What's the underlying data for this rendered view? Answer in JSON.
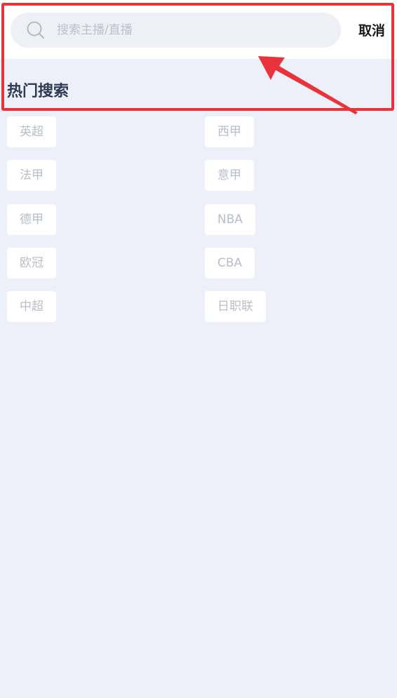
{
  "search": {
    "placeholder": "搜索主播/直播",
    "value": "",
    "cancel_label": "取消"
  },
  "hot_search": {
    "title": "热门搜索",
    "tags": [
      "英超",
      "西甲",
      "法甲",
      "意甲",
      "德甲",
      "NBA",
      "欧冠",
      "CBA",
      "中超",
      "日职联"
    ]
  },
  "icons": {
    "search": "search-icon"
  },
  "colors": {
    "background": "#eef0f9",
    "search_box": "#eef0f5",
    "tag_text": "#b9bdc8",
    "title_text": "#2f3a55",
    "annotation": "#e8333b"
  }
}
